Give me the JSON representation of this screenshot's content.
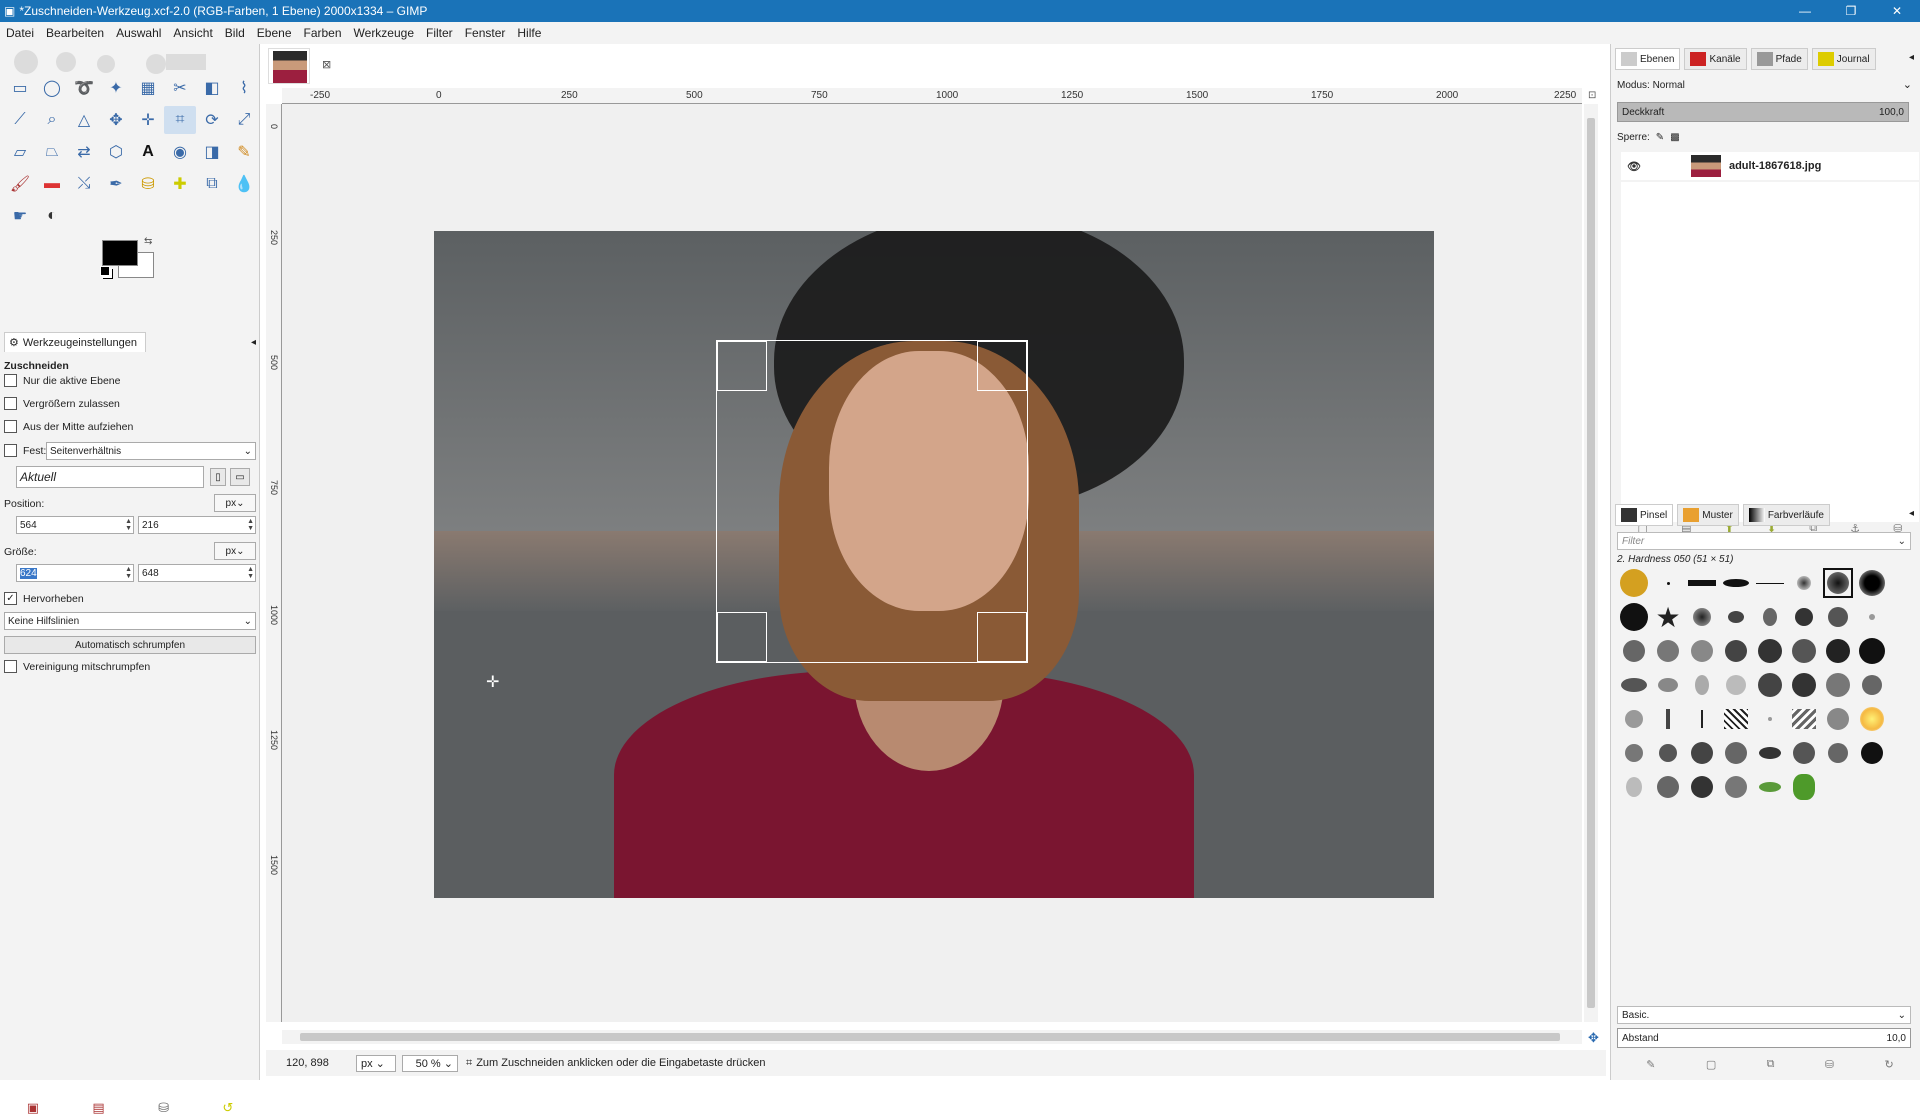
{
  "window": {
    "title": "*Zuschneiden-Werkzeug.xcf-2.0 (RGB-Farben, 1 Ebene) 2000x1334 – GIMP"
  },
  "menu": [
    "Datei",
    "Bearbeiten",
    "Auswahl",
    "Ansicht",
    "Bild",
    "Ebene",
    "Farben",
    "Werkzeuge",
    "Filter",
    "Fenster",
    "Hilfe"
  ],
  "tool_options": {
    "tab_label": "Werkzeugeinstellungen",
    "title": "Zuschneiden",
    "only_active_layer": "Nur die aktive Ebene",
    "allow_growing": "Vergrößern zulassen",
    "expand_from_center": "Aus der Mitte aufziehen",
    "fixed_label": "Fest:",
    "fixed_mode": "Seitenverhältnis",
    "current_value": "Aktuell",
    "position_label": "Position:",
    "position_unit": "px",
    "position_x": "564",
    "position_y": "216",
    "size_label": "Größe:",
    "size_unit": "px",
    "size_w": "624",
    "size_h": "648",
    "highlight_label": "Hervorheben",
    "guides_value": "Keine Hilfslinien",
    "auto_shrink_button": "Automatisch schrumpfen",
    "shrink_merged": "Vereinigung mitschrumpfen"
  },
  "ruler_h_labels": [
    "-250",
    "0",
    "250",
    "500",
    "750",
    "1000",
    "1250",
    "1500",
    "1750",
    "2000",
    "2250"
  ],
  "ruler_v_labels": [
    "0",
    "250",
    "500",
    "750",
    "1000",
    "1250",
    "1500"
  ],
  "status": {
    "coords": "120, 898",
    "unit": "px",
    "zoom": "50 %",
    "message": "Zum Zuschneiden anklicken oder die Eingabetaste drücken"
  },
  "layers_panel": {
    "tabs": [
      "Ebenen",
      "Kanäle",
      "Pfade",
      "Journal"
    ],
    "mode_label": "Modus:",
    "mode_value": "Normal",
    "opacity_label": "Deckkraft",
    "opacity_value": "100,0",
    "lock_label": "Sperre:",
    "layer_name": "adult-1867618.jpg"
  },
  "brushes_panel": {
    "tabs": [
      "Pinsel",
      "Muster",
      "Farbverläufe"
    ],
    "filter_placeholder": "Filter",
    "brush_name": "2. Hardness 050 (51 × 51)",
    "preset": "Basic.",
    "spacing_label": "Abstand",
    "spacing_value": "10,0"
  }
}
